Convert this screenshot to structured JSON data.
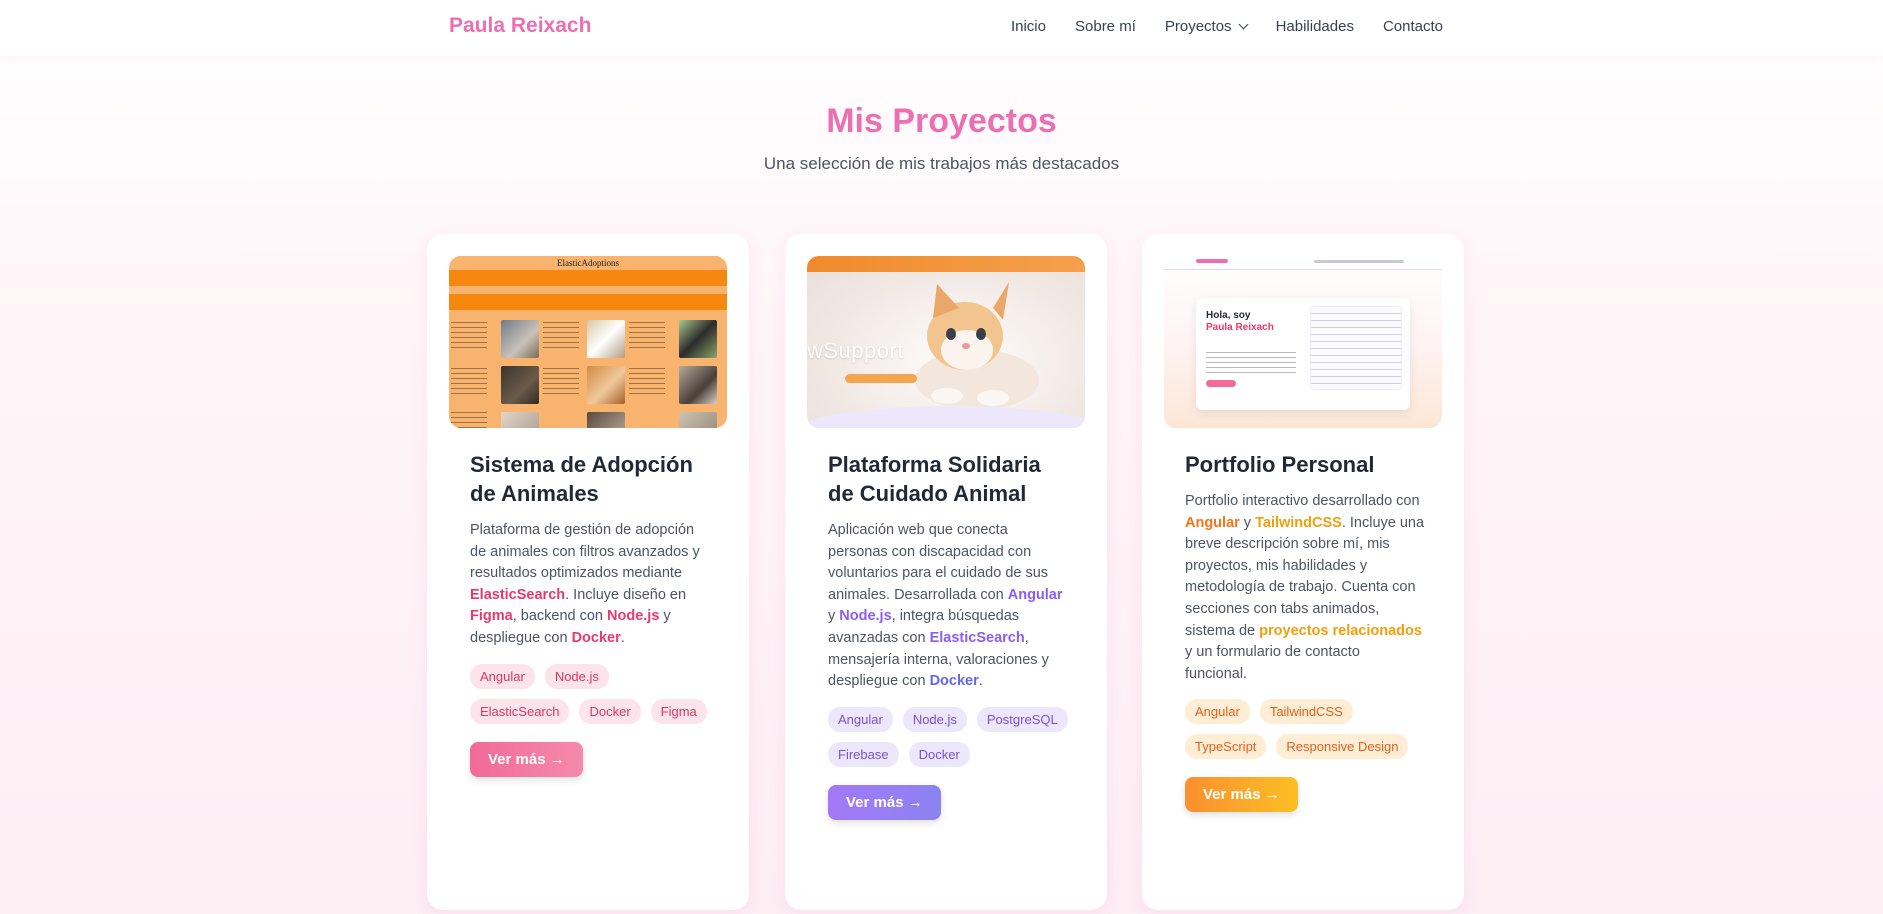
{
  "nav": {
    "brand": "Paula Reixach",
    "links": [
      "Inicio",
      "Sobre mí",
      "Proyectos",
      "Habilidades",
      "Contacto"
    ]
  },
  "section": {
    "title": "Mis Proyectos",
    "subtitle": "Una selección de mis trabajos más destacados"
  },
  "projects": [
    {
      "title": "Sistema de Adopción de Animales",
      "thumb_title": "ElasticAdoptions",
      "desc": [
        {
          "t": "Plataforma de gestión de adopción de animales con filtros avanzados y resultados optimizados mediante "
        },
        {
          "t": "ElasticSearch",
          "hl": true
        },
        {
          "t": ". Incluye diseño en "
        },
        {
          "t": "Figma",
          "hl": true
        },
        {
          "t": ", backend con "
        },
        {
          "t": "Node.js",
          "hl": true
        },
        {
          "t": " y despliegue con "
        },
        {
          "t": "Docker",
          "hl": true
        },
        {
          "t": "."
        }
      ],
      "tags": [
        "Angular",
        "Node.js",
        "ElasticSearch",
        "Docker",
        "Figma"
      ],
      "button": "Ver más →"
    },
    {
      "title": "Plataforma Solidaria de Cuidado Animal",
      "thumb_title": "wSupport",
      "desc": [
        {
          "t": "Aplicación web que conecta personas con discapacidad con voluntarios para el cuidado de sus animales. Desarrollada con "
        },
        {
          "t": "Angular",
          "hl": true
        },
        {
          "t": " y "
        },
        {
          "t": "Node.js",
          "hl": true
        },
        {
          "t": ", integra búsquedas avanzadas con "
        },
        {
          "t": "ElasticSearch",
          "hl": true
        },
        {
          "t": ", mensajería interna, valoraciones y despliegue con "
        },
        {
          "t": "Docker",
          "hl": true,
          "variant": "indigo"
        },
        {
          "t": "."
        }
      ],
      "tags": [
        "Angular",
        "Node.js",
        "PostgreSQL",
        "Firebase",
        "Docker"
      ],
      "button": "Ver más →"
    },
    {
      "title": "Portfolio Personal",
      "thumb_title": "Hola, soy",
      "thumb_name": "Paula Reixach",
      "desc": [
        {
          "t": "Portfolio interactivo desarrollado con "
        },
        {
          "t": "Angular",
          "hl": true,
          "variant": "or2"
        },
        {
          "t": " y "
        },
        {
          "t": "TailwindCSS",
          "hl": true
        },
        {
          "t": ". Incluye una breve descripción sobre mí, mis proyectos, mis habilidades y metodología de trabajo. Cuenta con secciones con tabs animados, sistema de "
        },
        {
          "t": "proyectos relacionados",
          "hl": true
        },
        {
          "t": " y un formulario de contacto funcional."
        }
      ],
      "tags": [
        "Angular",
        "TailwindCSS",
        "TypeScript",
        "Responsive Design"
      ],
      "button": "Ver más →"
    }
  ],
  "colors": {
    "brand_pink": "#ec6fb1",
    "pink_accent": "#e8386d",
    "purple_accent": "#8b5cf6",
    "orange_accent": "#f59e0b"
  }
}
